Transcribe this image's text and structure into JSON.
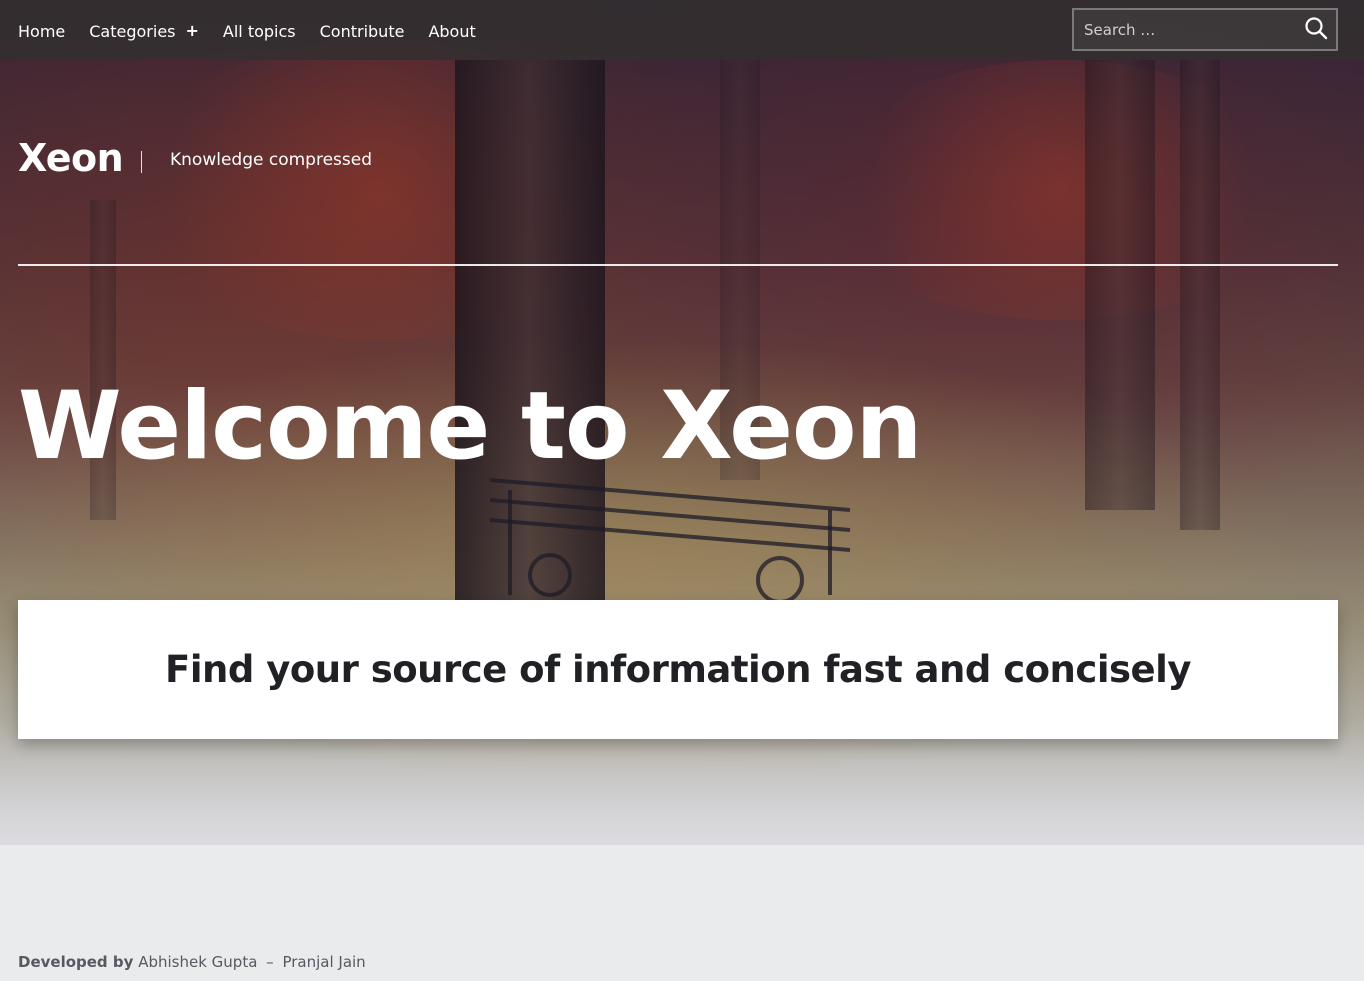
{
  "nav": {
    "items": [
      {
        "label": "Home",
        "active": true
      },
      {
        "label": "Categories",
        "has_submenu": true
      },
      {
        "label": "All topics"
      },
      {
        "label": "Contribute"
      },
      {
        "label": "About"
      }
    ]
  },
  "search": {
    "placeholder": "Search …",
    "value": ""
  },
  "branding": {
    "site_title": "Xeon",
    "tagline": "Knowledge compressed"
  },
  "hero": {
    "heading": "Welcome to Xeon",
    "card_text": "Find your source of information fast and concisely"
  },
  "footer": {
    "developed_by_label": "Developed by",
    "developer_1": "Abhishek Gupta",
    "separator": "–",
    "developer_2": "Pranjal Jain"
  },
  "icons": {
    "search": "search-icon",
    "submenu": "plus-icon"
  },
  "colors": {
    "nav_background": "#323030",
    "footer_background": "#e9ebed",
    "card_text": "#1f2125",
    "hero_text": "#ffffff"
  }
}
